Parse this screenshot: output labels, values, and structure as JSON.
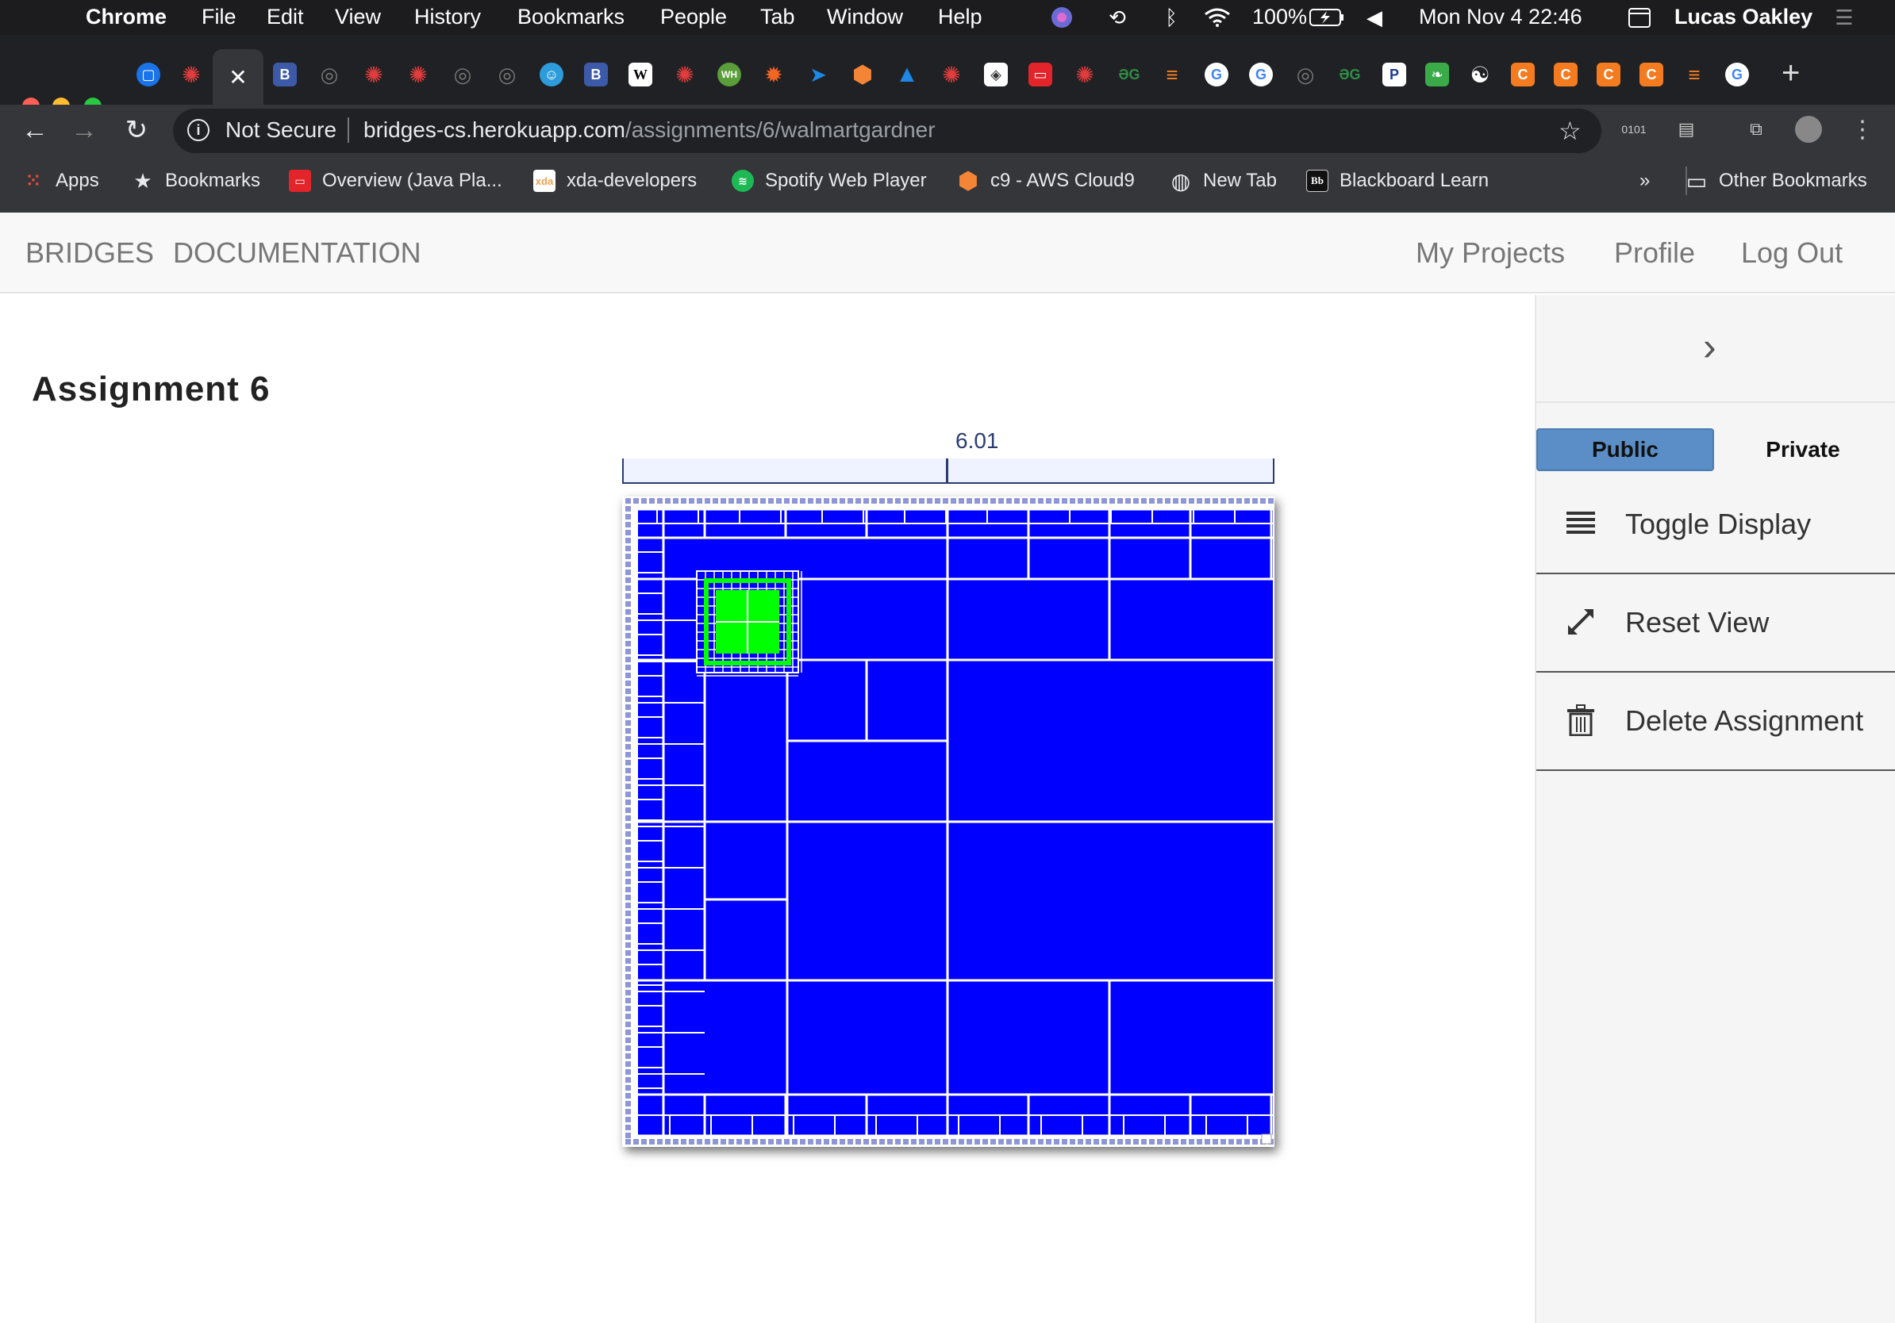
{
  "menubar": {
    "app": "Chrome",
    "items": [
      "File",
      "Edit",
      "View",
      "History",
      "Bookmarks",
      "People",
      "Tab",
      "Window",
      "Help"
    ],
    "battery": "100%",
    "datetime": "Mon Nov 4  22:46",
    "user": "Lucas Oakley"
  },
  "browser": {
    "active_tab_icon": "close-icon",
    "security": "Not Secure",
    "url_host": "bridges-cs.herokuapp.com",
    "url_path": "/assignments/6/walmartgardner"
  },
  "bookmarks": {
    "items": [
      {
        "label": "Apps",
        "icon": "apps-grid-icon",
        "color": "#e74c3c"
      },
      {
        "label": "Bookmarks",
        "icon": "star-icon",
        "color": "#e8eaed"
      },
      {
        "label": "Overview (Java Pla...",
        "icon": "oracle-icon",
        "color": "#e3242b"
      },
      {
        "label": "xda-developers",
        "icon": "xda-icon",
        "color": "#f0a04b"
      },
      {
        "label": "Spotify Web Player",
        "icon": "spotify-icon",
        "color": "#1db954"
      },
      {
        "label": "c9 - AWS Cloud9",
        "icon": "cloud9-icon",
        "color": "#f58536"
      },
      {
        "label": "New Tab",
        "icon": "globe-icon",
        "color": "#e8eaed"
      },
      {
        "label": "Blackboard Learn",
        "icon": "blackboard-icon",
        "color": "#222"
      }
    ],
    "overflow": "»",
    "other": "Other Bookmarks"
  },
  "site": {
    "brand": "BRIDGES",
    "docs": "DOCUMENTATION",
    "my_projects": "My Projects",
    "profile": "Profile",
    "logout": "Log Out"
  },
  "main": {
    "title": "Assignment 6",
    "scale_value": "6.01"
  },
  "visualization": {
    "type": "quadtree",
    "fill_color": "#0000ff",
    "highlight_color": "#00ff00",
    "line_color": "#ffffff"
  },
  "sidebar": {
    "public_label": "Public",
    "private_label": "Private",
    "actions": [
      {
        "label": "Toggle Display",
        "icon": "list-icon"
      },
      {
        "label": "Reset View",
        "icon": "expand-arrows-icon"
      },
      {
        "label": "Delete Assignment",
        "icon": "trash-icon"
      }
    ]
  }
}
